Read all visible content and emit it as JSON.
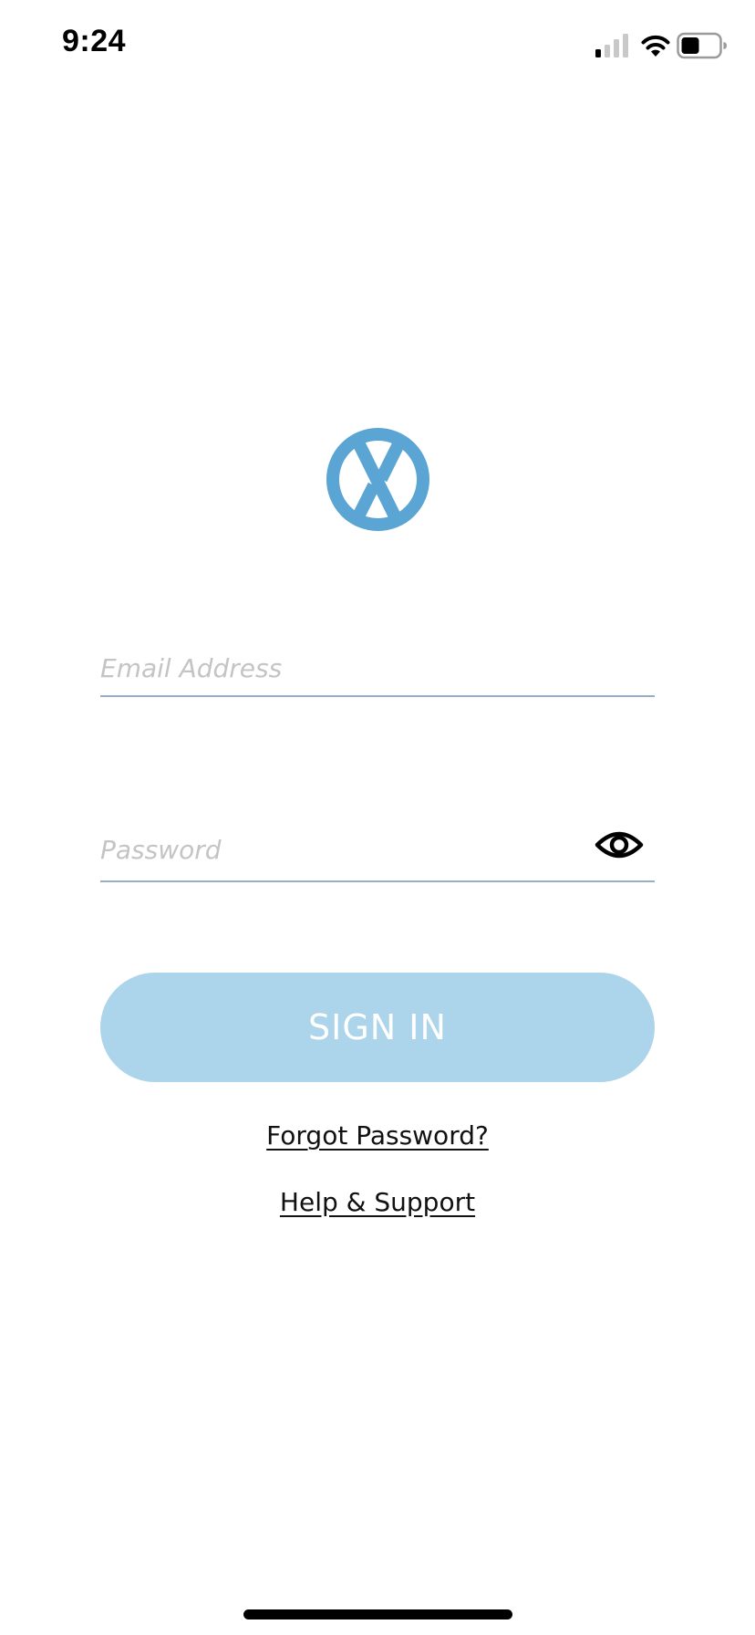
{
  "status_bar": {
    "time": "9:24",
    "signal_icon": "cellular-signal-icon",
    "wifi_icon": "wifi-icon",
    "battery_icon": "battery-icon",
    "signal_bars_filled": 1,
    "signal_bars_total": 4,
    "battery_level": 0.5
  },
  "logo": {
    "icon": "x-circle-logo-icon",
    "color": "#5aa5d3"
  },
  "form": {
    "email": {
      "placeholder": "Email Address",
      "value": ""
    },
    "password": {
      "placeholder": "Password",
      "value": "",
      "toggle_icon": "eye-icon"
    },
    "sign_in_label": "SIGN IN",
    "sign_in_color": "#acd4ea"
  },
  "links": {
    "forgot_password": "Forgot Password?",
    "help_support": "Help & Support"
  },
  "colors": {
    "background": "#ffffff",
    "field_underline": "#9aadc4",
    "placeholder": "#c4c4c4"
  }
}
